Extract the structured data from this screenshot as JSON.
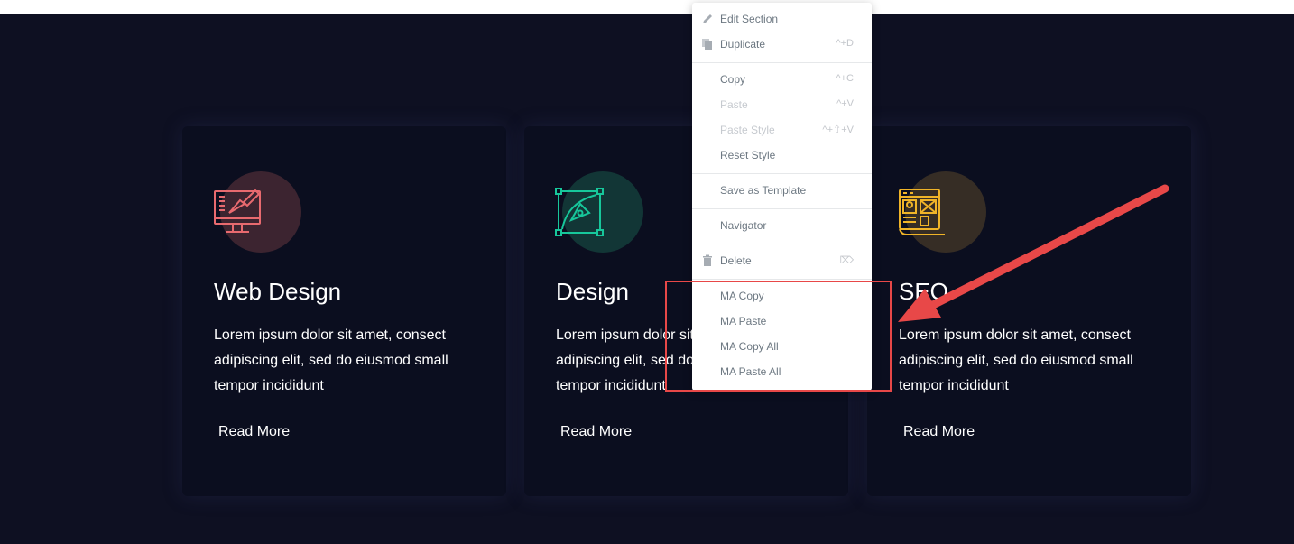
{
  "cards": [
    {
      "title": "Web Design",
      "text": "Lorem ipsum dolor sit amet, consect adipiscing elit, sed do eiusmod small tempor incididunt",
      "link": "Read More",
      "icon": "web-design-monitor-icon",
      "accent": "#e86a6f",
      "circle": "#3c2430"
    },
    {
      "title": "Design",
      "text": "Lorem ipsum dolor sit amet, consect adipiscing elit, sed do eiusmod small tempor incididunt",
      "link": "Read More",
      "icon": "pen-tool-icon",
      "accent": "#17c79b",
      "circle": "#123636"
    },
    {
      "title": "SEO",
      "text": "Lorem ipsum dolor sit amet, consect adipiscing elit, sed do eiusmod small tempor incididunt",
      "link": "Read More",
      "icon": "seo-browser-icon",
      "accent": "#f0b428",
      "circle": "#362d25"
    }
  ],
  "context_menu": {
    "edit_section": "Edit Section",
    "duplicate": "Duplicate",
    "duplicate_shortcut": "^+D",
    "copy": "Copy",
    "copy_shortcut": "^+C",
    "paste": "Paste",
    "paste_shortcut": "^+V",
    "paste_style": "Paste Style",
    "paste_style_shortcut": "^+⇧+V",
    "reset_style": "Reset Style",
    "save_as_template": "Save as Template",
    "navigator": "Navigator",
    "delete": "Delete",
    "delete_shortcut": "⌦",
    "ma_copy": "MA Copy",
    "ma_paste": "MA Paste",
    "ma_copy_all": "MA Copy All",
    "ma_paste_all": "MA Paste All"
  },
  "annotation": {
    "color": "#e84848"
  }
}
